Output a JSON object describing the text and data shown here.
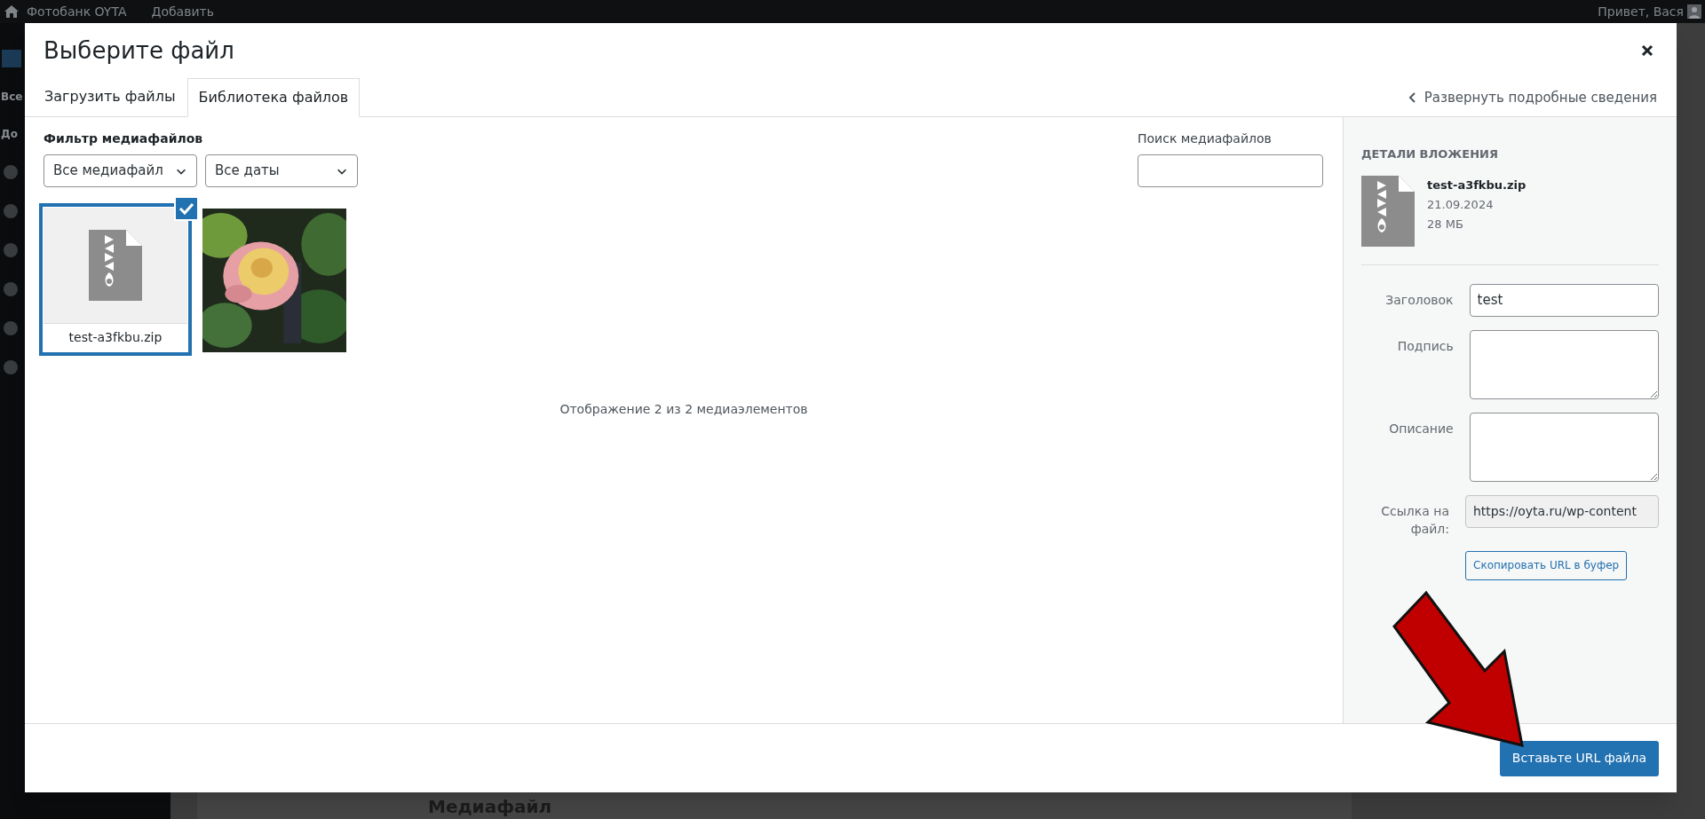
{
  "admin_bar": {
    "site": "Фотобанк OYTA",
    "add": "Добавить",
    "greeting": "Привет, Вася"
  },
  "admin_menu": {
    "items": [
      "Все",
      "До"
    ]
  },
  "background_heading": "Медиафайл",
  "dialog": {
    "title": "Выберите файл",
    "tabs": [
      {
        "label": "Загрузить файлы",
        "selected": false
      },
      {
        "label": "Библиотека файлов",
        "selected": true
      }
    ],
    "expand_details": "Развернуть подробные сведения",
    "filter": {
      "label": "Фильтр медиафайлов",
      "type_select": "Все медиафайл",
      "date_select": "Все даты"
    },
    "search": {
      "label": "Поиск медиафайлов"
    },
    "items": [
      {
        "kind": "file",
        "filename": "test-a3fkbu.zip",
        "selected": true
      },
      {
        "kind": "picture",
        "selected": false
      }
    ],
    "count": "Отображение 2 из 2 медиаэлементов",
    "details": {
      "heading": "ДЕТАЛИ ВЛОЖЕНИЯ",
      "filename": "test-a3fkbu.zip",
      "date": "21.09.2024",
      "size": "28 МБ",
      "fields": [
        {
          "kind": "input",
          "label": "Заголовок",
          "value": "test"
        },
        {
          "kind": "textarea",
          "label": "Подпись"
        },
        {
          "kind": "textarea",
          "label": "Описание"
        },
        {
          "kind": "readonly",
          "label": "Ссылка на файл:",
          "value": "https://oyta.ru/wp-content"
        }
      ],
      "copy_button": "Скопировать URL в буфер"
    },
    "insert_button": "Вставьте URL файла"
  }
}
